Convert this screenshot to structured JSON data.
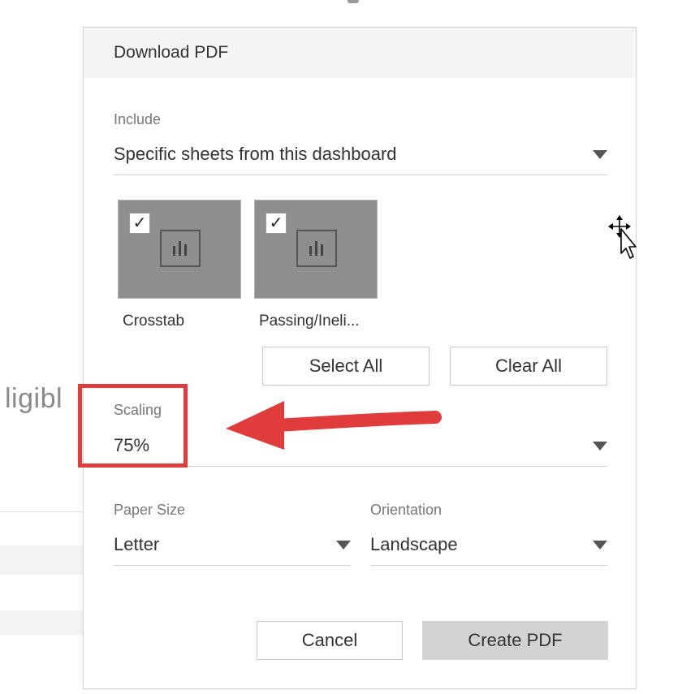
{
  "background": {
    "partial_text": "ligibl"
  },
  "dialog": {
    "title": "Download PDF",
    "include": {
      "label": "Include",
      "value": "Specific sheets from this dashboard"
    },
    "sheets": [
      {
        "name": "Crosstab",
        "checked": true
      },
      {
        "name": "Passing/Ineli...",
        "checked": true
      }
    ],
    "checkmark": "✓",
    "select_all_label": "Select All",
    "clear_all_label": "Clear All",
    "scaling": {
      "label": "Scaling",
      "value": "75%"
    },
    "paper_size": {
      "label": "Paper Size",
      "value": "Letter"
    },
    "orientation": {
      "label": "Orientation",
      "value": "Landscape"
    },
    "cancel_label": "Cancel",
    "create_label": "Create PDF"
  },
  "colors": {
    "annotation_red": "#e03c3c",
    "header_bg": "#f5f5f5",
    "thumbnail_bg": "#8e8e8e",
    "primary_button_bg": "#d3d3d3"
  },
  "icons": [
    "chart-bars-icon",
    "checkbox-checked-icon",
    "caret-down-icon",
    "move-cursor-icon",
    "annotation-arrow-icon"
  ]
}
